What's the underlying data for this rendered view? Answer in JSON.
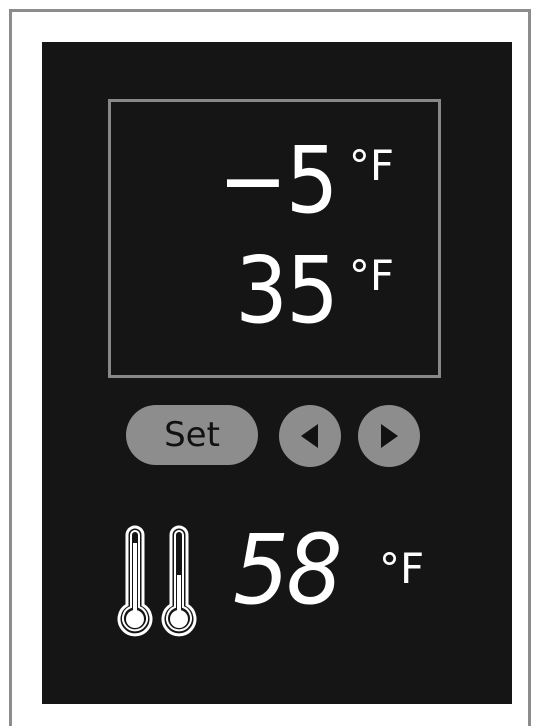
{
  "display": {
    "top_reading": {
      "value": "−5",
      "unit": "°F"
    },
    "bottom_reading": {
      "value": "35",
      "unit": "°F"
    }
  },
  "controls": {
    "set_label": "Set",
    "left_icon": "triangle-left-icon",
    "right_icon": "triangle-right-icon"
  },
  "current_temperature": {
    "icon": "thermometer-icon",
    "value": "58",
    "unit": "°F"
  },
  "colors": {
    "panel_background": "#161515",
    "button_fill": "#8d8d8d",
    "display_border": "#888888",
    "text": "#ffffff"
  }
}
